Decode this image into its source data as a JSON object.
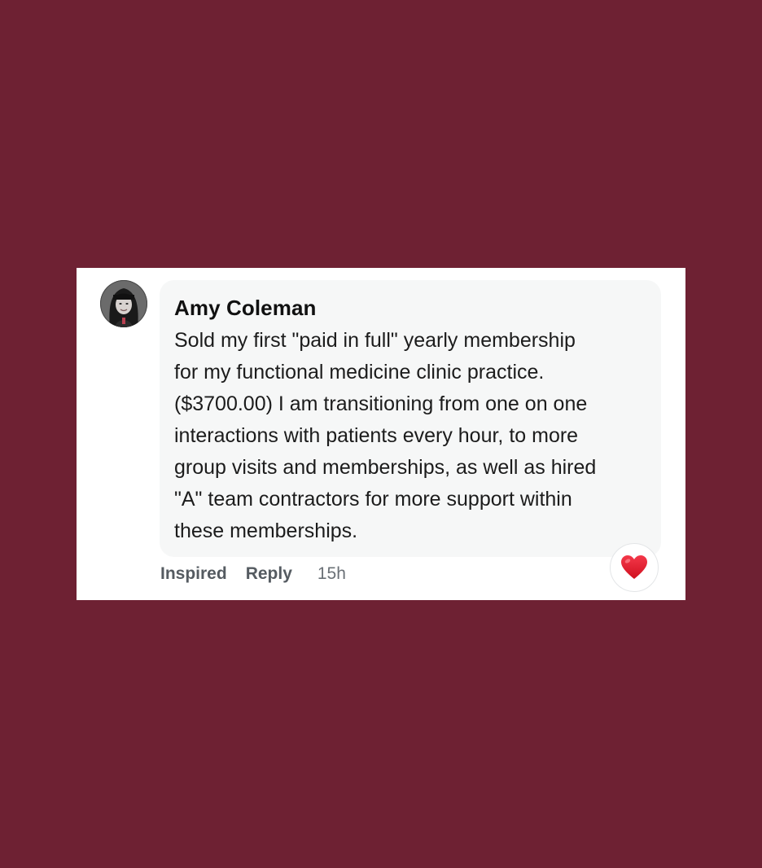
{
  "colors": {
    "page_background": "#6e2133",
    "card_background": "#ffffff",
    "bubble_background": "#f6f7f7",
    "heart": "#e0192b"
  },
  "comment": {
    "author": "Amy Coleman",
    "text": "Sold my first \"paid in full\" yearly membership\nfor my functional medicine clinic practice.\n($3700.00) I am transitioning from one on one\ninteractions with patients every hour, to more\ngroup visits and memberships, as well as hired\n\"A\" team contractors for more support within\nthese memberships.",
    "avatar_icon": "avatar-photo"
  },
  "actions": {
    "inspired_label": "Inspired",
    "reply_label": "Reply",
    "timestamp": "15h"
  },
  "reaction": {
    "icon": "heart-icon"
  }
}
